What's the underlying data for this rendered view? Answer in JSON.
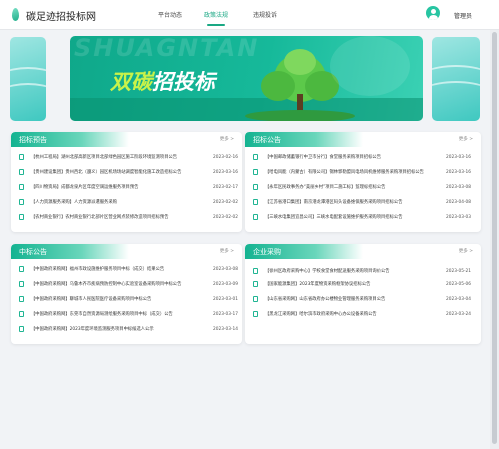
{
  "app": {
    "title": "碳足迹招投标网",
    "username": "管理员"
  },
  "nav": [
    {
      "label": "平台动态",
      "active": false
    },
    {
      "label": "政策法规",
      "active": true
    },
    {
      "label": "违规投诉",
      "active": false
    }
  ],
  "banner": {
    "bg_text": "SHUAGNTAN",
    "title_part1": "双碳",
    "title_part2": "招投标"
  },
  "colors": {
    "accent": "#1aa884",
    "panel_header": "#14b391",
    "banner": "#0fa88a",
    "banner_title": "#c8f24a"
  },
  "icons": {
    "logo": "leaf-logo-icon",
    "avatar": "user-avatar-icon",
    "row": "document-icon"
  },
  "panels": {
    "zbyg": {
      "title": "招标预告",
      "more": "更多 >",
      "rows": [
        {
          "text": "【杭州工程局】湖州北部高新区项目北部绿色园区施工阶段环境监测项目公告",
          "date": "2023-02-16"
        },
        {
          "text": "【贵州建设集团】贵州西北（遵义）园区机场场站调度智能化施工改造招标公告",
          "date": "2023-03-16"
        },
        {
          "text": "【四川物资局】成都龙泉片区年度空调运维服务项目预告",
          "date": "2023-02-17"
        },
        {
          "text": "【人力资源服务采购】人力资源派遣服务采购",
          "date": "2023-02-02"
        },
        {
          "text": "【农村商业银行】农村商业银行北部片区营业网点装修改造项目招标预告",
          "date": "2023-02-02"
        }
      ]
    },
    "zbgg": {
      "title": "招标公告",
      "more": "更多 >",
      "rows": [
        {
          "text": "【中国邮政储蓄银行中卫市分行】食堂服务采购项目招标公告",
          "date": "2023-03-16"
        },
        {
          "text": "【哈电风能（内蒙古）有限公司】锡林郭勒盟风电场风机维修服务采购项目招标公告",
          "date": "2023-03-16"
        },
        {
          "text": "【永年区民政事务办“美丽乡村”项目二施工标】监理标招标公告",
          "date": "2023-03-08"
        },
        {
          "text": "【江苏省港口集团】南京港龙潭港区码头设备维保服务采购项目招标公告",
          "date": "2023-04-08"
        },
        {
          "text": "【三峡水电集团宜昌公司】三峡水电配套设施维护服务采购项目招标公告",
          "date": "2023-03-03"
        }
      ]
    },
    "zbgs": {
      "title": "中标公告",
      "more": "更多 >",
      "rows": [
        {
          "text": "【中国政府采购网】福州市政设施维护服务项目中标（成交）结果公告",
          "date": "2023-03-08"
        },
        {
          "text": "【中国政府采购网】乌鲁木齐市疾病预防控制中心实验室设备采购项目中标公告",
          "date": "2023-03-09"
        },
        {
          "text": "【中国政府采购网】聊城市人民医院医疗设备采购项目中标公告",
          "date": "2023-03-01"
        },
        {
          "text": "【中国政府采购网】东莞市自然资源局测绘服务采购项目中标（成交）公告",
          "date": "2023-03-17"
        },
        {
          "text": "【中国政府采购网】2023年度环境监测服务项目中标候选人公示",
          "date": "2023-03-14"
        }
      ]
    },
    "qycg": {
      "title": "企业采购",
      "more": "更多 >",
      "rows": [
        {
          "text": "【徐州区政府采购中心】学校食堂食材配送服务采购项目询价公告",
          "date": "2023-05-21"
        },
        {
          "text": "【国家能源集团】2023年度物资采购框架协议招标公告",
          "date": "2023-05-06"
        },
        {
          "text": "【山东省采购网】山东省政府办公楼物业管理服务采购项目公告",
          "date": "2023-03-04"
        },
        {
          "text": "【黑龙江采购网】哈尔滨市政府采购中心办公设备采购公告",
          "date": "2023-03-24"
        }
      ]
    }
  }
}
